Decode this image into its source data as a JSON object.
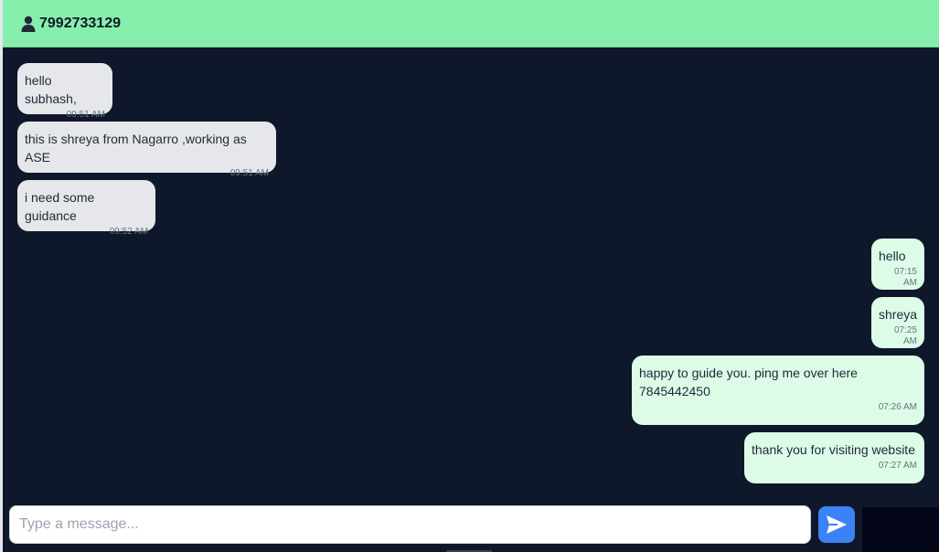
{
  "header": {
    "phone": "7992733129",
    "icon": "user-icon"
  },
  "messages": [
    {
      "direction": "incoming",
      "text": "hello subhash,",
      "time": "09:51 AM"
    },
    {
      "direction": "incoming",
      "text": "this is shreya from Nagarro ,working as ASE",
      "time": "09:51 AM"
    },
    {
      "direction": "incoming",
      "text": "i need some guidance",
      "time": "09:52 AM"
    },
    {
      "direction": "outgoing",
      "text": "hello",
      "time": "07:15 AM"
    },
    {
      "direction": "outgoing",
      "text": "shreya",
      "time": "07:25 AM"
    },
    {
      "direction": "outgoing",
      "text": "happy to guide you. ping me over here\n7845442450",
      "time": "07:26 AM"
    },
    {
      "direction": "outgoing",
      "text": "thank you for visiting website",
      "time": "07:27 AM"
    }
  ],
  "composer": {
    "placeholder": "Type a message...",
    "value": ""
  },
  "send": {
    "icon": "send-icon"
  },
  "colors": {
    "header_bg": "#86efac",
    "chat_bg": "#0f172a",
    "incoming_bubble": "#e5e7eb",
    "outgoing_bubble": "#dcfce7",
    "send_button": "#3b82f6"
  }
}
